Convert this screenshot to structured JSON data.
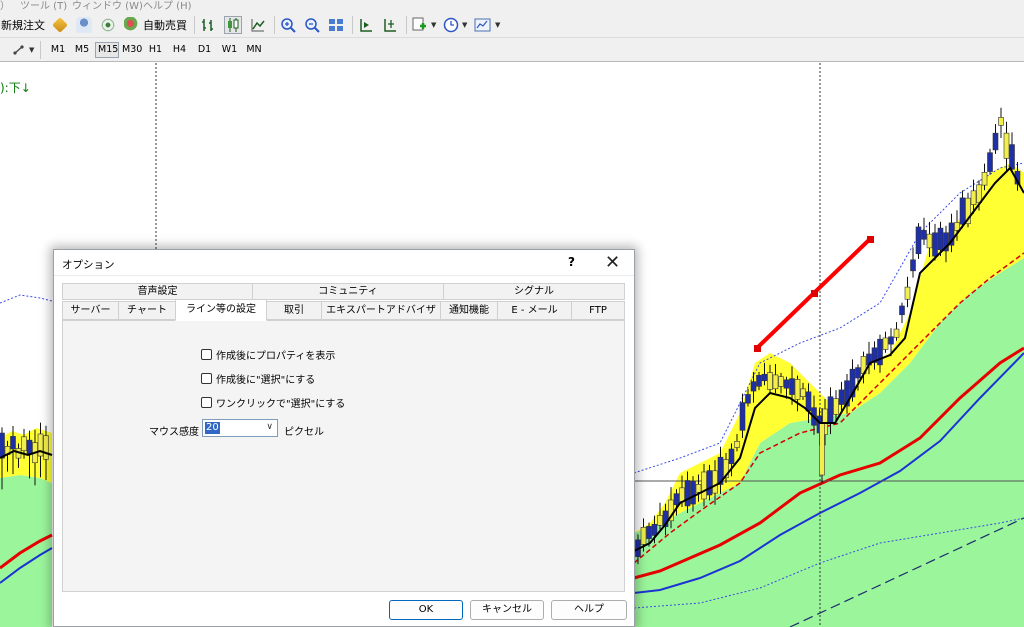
{
  "menubar": {
    "items": [
      "）",
      "ツール (T)",
      "ウィンドウ (W)",
      "ヘルプ (H)"
    ]
  },
  "toolbar": {
    "new_order": "新規注文",
    "auto_trade": "自動売買"
  },
  "timeframes": [
    "M1",
    "M5",
    "M15",
    "M30",
    "H1",
    "H4",
    "D1",
    "W1",
    "MN"
  ],
  "active_timeframe": "M15",
  "chart": {
    "status_text": "):下↓",
    "colors": {
      "bull_candle": "#1e2fa8",
      "bear_candle": "#f2ee4c",
      "band_yellow": "#ffff33",
      "band_green": "#9bf59b",
      "cloud": "#00f582",
      "red_line": "#e60000",
      "blue_line": "#1b33d4",
      "trendline": "#ff0000"
    }
  },
  "dialog": {
    "title": "オプション",
    "help": "?",
    "close": "✕",
    "tabs_row1": [
      "音声設定",
      "コミュニティ",
      "シグナル"
    ],
    "tabs_row2": [
      "サーバー",
      "チャート",
      "ライン等の設定",
      "取引",
      "エキスパートアドバイザ",
      "通知機能",
      "E - メール",
      "FTP"
    ],
    "active_tab": "ライン等の設定",
    "checkboxes": [
      {
        "label": "作成後にプロパティを表示",
        "checked": false
      },
      {
        "label": "作成後に\"選択\"にする",
        "checked": false
      },
      {
        "label": "ワンクリックで\"選択\"にする",
        "checked": false
      }
    ],
    "mouse_sensitivity_label": "マウス感度",
    "mouse_sensitivity_value": "20",
    "mouse_sensitivity_unit": "ピクセル",
    "buttons": {
      "ok": "OK",
      "cancel": "キャンセル",
      "help": "ヘルプ"
    }
  }
}
